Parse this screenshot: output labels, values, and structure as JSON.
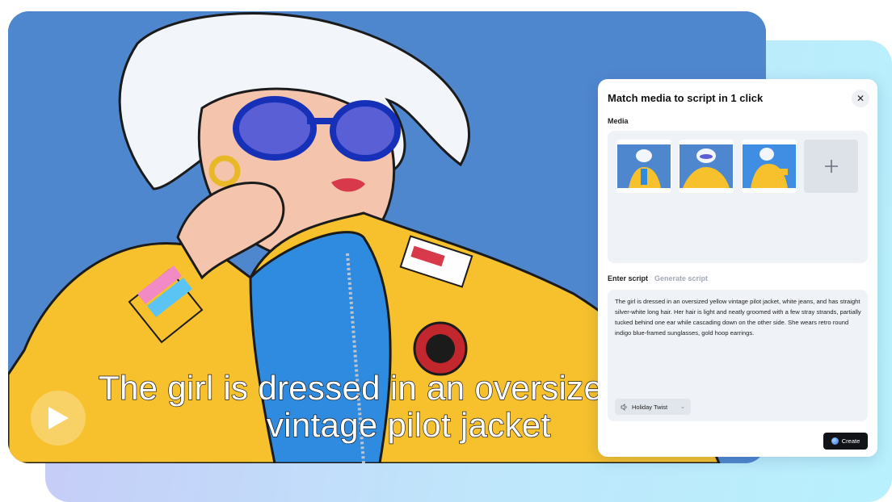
{
  "video": {
    "subtitle_line1": "The girl is dressed in an oversize",
    "subtitle_line2": "vintage pilot jacket"
  },
  "panel": {
    "title": "Match media to script in 1 click",
    "close_icon": "close-icon",
    "media_label": "Media",
    "add_icon": "plus-icon",
    "tabs": [
      {
        "label": "Enter script",
        "active": true
      },
      {
        "label": "Generate script",
        "active": false
      }
    ],
    "script_text": "The girl is dressed in an oversized yellow vintage pilot jacket, white jeans, and has straight silver-white long hair. Her hair is light and neatly groomed with a few stray strands, partially tucked behind one ear while cascading down on the other side. She wears retro round indigo blue-framed sunglasses, gold hoop earrings.",
    "voice": {
      "label": "Holiday Twist",
      "icon": "voice-icon"
    },
    "create_label": "Create"
  },
  "colors": {
    "accent_yellow": "#f6c12c",
    "sky_blue": "#4f87cf",
    "create_button": "#121318"
  }
}
